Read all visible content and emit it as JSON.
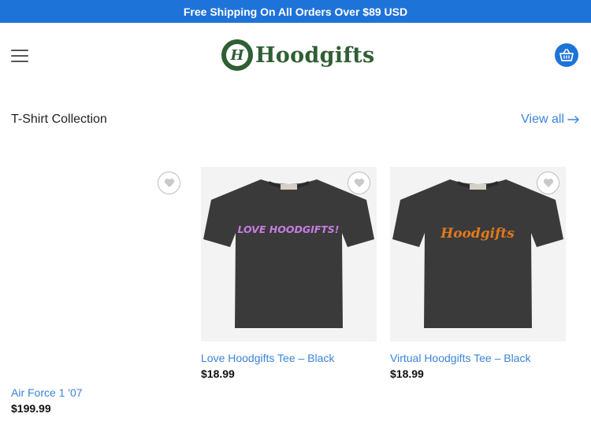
{
  "announcement": "Free Shipping On All Orders Over $89 USD",
  "logo": {
    "badge_letter": "H",
    "text": "Hoodgifts"
  },
  "icons": {
    "menu": "menu-icon",
    "cart": "basket-icon",
    "wishlist": "heart-icon",
    "arrow": "arrow-right-icon"
  },
  "section": {
    "title": "T-Shirt Collection",
    "view_all": "View all"
  },
  "products": [
    {
      "name": "Air Force 1 '07",
      "price": "$199.99",
      "tshirt_print": ""
    },
    {
      "name": "Love Hoodgifts Tee – Black",
      "price": "$18.99",
      "tshirt_print": "LOVE HOODGIFTS!"
    },
    {
      "name": "Virtual Hoodgifts Tee – Black",
      "price": "$18.99",
      "tshirt_print": "Hoodgifts"
    }
  ],
  "colors": {
    "accent": "#1e73d8",
    "link": "#3a84d8",
    "brand_green": "#2f5f34"
  }
}
